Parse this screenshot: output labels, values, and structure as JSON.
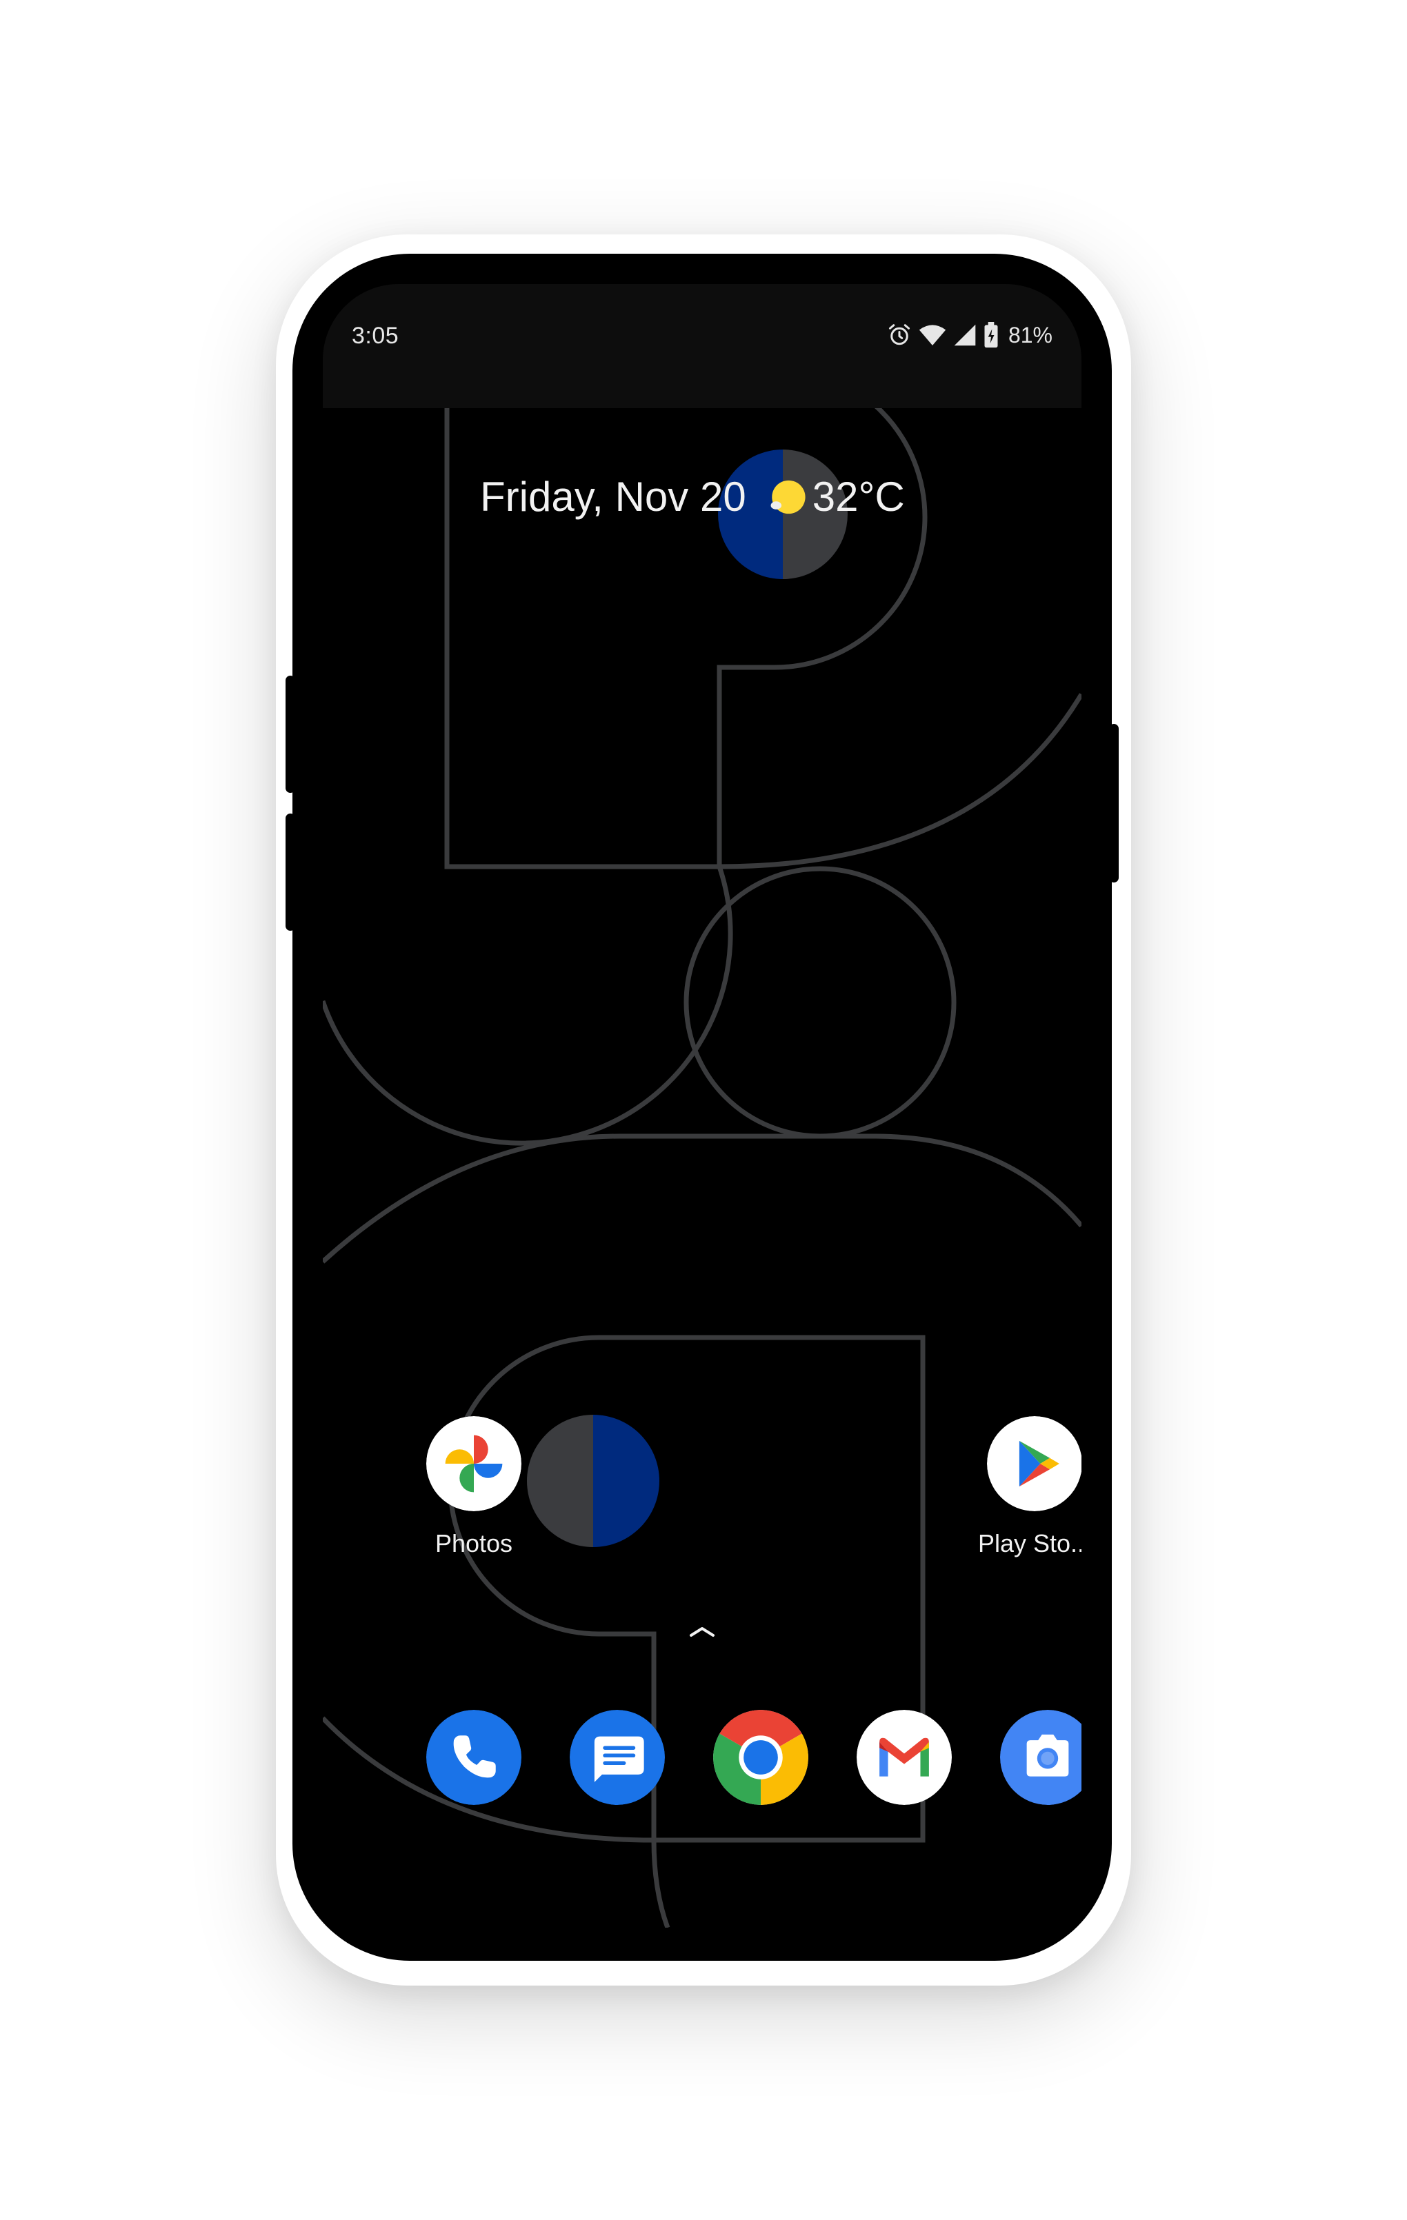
{
  "status_bar": {
    "time": "3:05",
    "icons": [
      "alarm-icon",
      "wifi-icon",
      "cell-signal-icon",
      "battery-charging-icon"
    ],
    "battery_percent": "81%"
  },
  "at_a_glance": {
    "date": "Friday, Nov 20",
    "weather_icon": "sun-icon",
    "temperature": "32°C"
  },
  "home_apps": [
    {
      "label": "Photos",
      "icon": "photos-icon"
    },
    {
      "label": "Play Sto...",
      "icon": "play-store-icon"
    }
  ],
  "dock": [
    {
      "icon": "phone-icon"
    },
    {
      "icon": "messages-icon"
    },
    {
      "icon": "chrome-icon"
    },
    {
      "icon": "gmail-icon"
    },
    {
      "icon": "camera-icon"
    }
  ],
  "colors": {
    "wallpaper_line": "#3a3b3d",
    "wallpaper_navy": "#002a7e",
    "wallpaper_gray": "#3b3c3f",
    "google_blue": "#1a73e8",
    "google_red": "#ea4335",
    "google_yellow": "#fbbc04",
    "google_green": "#34a853"
  }
}
